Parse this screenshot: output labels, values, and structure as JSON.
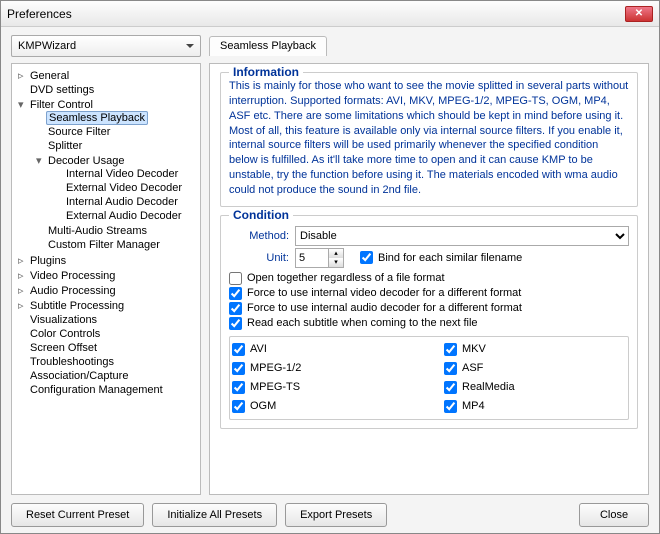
{
  "window": {
    "title": "Preferences"
  },
  "preset": {
    "selected": "KMPWizard"
  },
  "tree": {
    "items": [
      {
        "label": "General",
        "leaf": true,
        "exp": "▹"
      },
      {
        "label": "DVD settings",
        "leaf": true
      },
      {
        "label": "Filter Control",
        "exp": "▾",
        "children": [
          {
            "label": "Seamless Playback",
            "sel": true
          },
          {
            "label": "Source Filter"
          },
          {
            "label": "Splitter"
          },
          {
            "label": "Decoder Usage",
            "exp": "▾",
            "children": [
              {
                "label": "Internal Video Decoder"
              },
              {
                "label": "External Video Decoder"
              },
              {
                "label": "Internal Audio Decoder"
              },
              {
                "label": "External Audio Decoder"
              }
            ]
          },
          {
            "label": "Multi-Audio Streams"
          },
          {
            "label": "Custom Filter Manager"
          }
        ]
      },
      {
        "label": "Plugins",
        "exp": "▹"
      },
      {
        "label": "Video Processing",
        "exp": "▹"
      },
      {
        "label": "Audio Processing",
        "exp": "▹"
      },
      {
        "label": "Subtitle Processing",
        "exp": "▹"
      },
      {
        "label": "Visualizations"
      },
      {
        "label": "Color Controls"
      },
      {
        "label": "Screen Offset"
      },
      {
        "label": "Troubleshootings"
      },
      {
        "label": "Association/Capture"
      },
      {
        "label": "Configuration Management"
      }
    ]
  },
  "tab": {
    "label": "Seamless Playback"
  },
  "info": {
    "title": "Information",
    "text": "This is mainly for those who want to see the movie splitted in several parts without interruption. Supported formats: AVI, MKV, MPEG-1/2, MPEG-TS, OGM, MP4, ASF etc. There are some limitations which should be kept in mind before using it. Most of all, this feature is available only via internal source filters. If you enable it, internal source filters will be used primarily whenever the specified condition below is fulfilled. As it'll take more time to open and it can cause KMP to be unstable, try the function before using it. The materials encoded with wma audio could not produce the sound in 2nd file."
  },
  "condition": {
    "title": "Condition",
    "method_label": "Method:",
    "method_value": "Disable",
    "unit_label": "Unit:",
    "unit_value": "5",
    "bind_label": "Bind for each similar filename",
    "bind_checked": true,
    "opts": [
      {
        "label": "Open together regardless of a file format",
        "checked": false
      },
      {
        "label": "Force to use internal video decoder for a different format",
        "checked": true
      },
      {
        "label": "Force to use internal audio decoder for a different format",
        "checked": true
      },
      {
        "label": "Read each subtitle when coming to the next file",
        "checked": true
      }
    ],
    "formats": [
      {
        "label": "AVI",
        "checked": true
      },
      {
        "label": "MKV",
        "checked": true
      },
      {
        "label": "MPEG-1/2",
        "checked": true
      },
      {
        "label": "ASF",
        "checked": true
      },
      {
        "label": "MPEG-TS",
        "checked": true
      },
      {
        "label": "RealMedia",
        "checked": true
      },
      {
        "label": "OGM",
        "checked": true
      },
      {
        "label": "MP4",
        "checked": true
      }
    ]
  },
  "buttons": {
    "reset": "Reset Current Preset",
    "init": "Initialize All Presets",
    "export": "Export Presets",
    "close": "Close"
  }
}
